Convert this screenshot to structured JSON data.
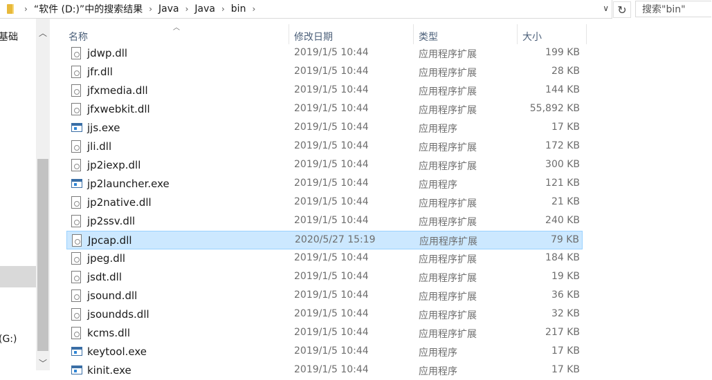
{
  "address": {
    "crumbs": [
      "“软件 (D:)”中的搜索结果",
      "Java",
      "Java",
      "bin"
    ]
  },
  "search": {
    "placeholder": "搜索\"bin\""
  },
  "nav": {
    "item_top": "基础",
    "item_drive": "(G:)"
  },
  "columns": {
    "name": "名称",
    "date": "修改日期",
    "type": "类型",
    "size": "大小"
  },
  "files": [
    {
      "name": "jdwp.dll",
      "date": "2019/1/5 10:44",
      "type": "应用程序扩展",
      "size": "199 KB",
      "kind": "dll"
    },
    {
      "name": "jfr.dll",
      "date": "2019/1/5 10:44",
      "type": "应用程序扩展",
      "size": "28 KB",
      "kind": "dll"
    },
    {
      "name": "jfxmedia.dll",
      "date": "2019/1/5 10:44",
      "type": "应用程序扩展",
      "size": "144 KB",
      "kind": "dll"
    },
    {
      "name": "jfxwebkit.dll",
      "date": "2019/1/5 10:44",
      "type": "应用程序扩展",
      "size": "55,892 KB",
      "kind": "dll"
    },
    {
      "name": "jjs.exe",
      "date": "2019/1/5 10:44",
      "type": "应用程序",
      "size": "17 KB",
      "kind": "exe"
    },
    {
      "name": "jli.dll",
      "date": "2019/1/5 10:44",
      "type": "应用程序扩展",
      "size": "172 KB",
      "kind": "dll"
    },
    {
      "name": "jp2iexp.dll",
      "date": "2019/1/5 10:44",
      "type": "应用程序扩展",
      "size": "300 KB",
      "kind": "dll"
    },
    {
      "name": "jp2launcher.exe",
      "date": "2019/1/5 10:44",
      "type": "应用程序",
      "size": "121 KB",
      "kind": "exe"
    },
    {
      "name": "jp2native.dll",
      "date": "2019/1/5 10:44",
      "type": "应用程序扩展",
      "size": "21 KB",
      "kind": "dll"
    },
    {
      "name": "jp2ssv.dll",
      "date": "2019/1/5 10:44",
      "type": "应用程序扩展",
      "size": "240 KB",
      "kind": "dll"
    },
    {
      "name": "Jpcap.dll",
      "date": "2020/5/27 15:19",
      "type": "应用程序扩展",
      "size": "79 KB",
      "kind": "dll",
      "selected": true
    },
    {
      "name": "jpeg.dll",
      "date": "2019/1/5 10:44",
      "type": "应用程序扩展",
      "size": "184 KB",
      "kind": "dll"
    },
    {
      "name": "jsdt.dll",
      "date": "2019/1/5 10:44",
      "type": "应用程序扩展",
      "size": "19 KB",
      "kind": "dll"
    },
    {
      "name": "jsound.dll",
      "date": "2019/1/5 10:44",
      "type": "应用程序扩展",
      "size": "36 KB",
      "kind": "dll"
    },
    {
      "name": "jsoundds.dll",
      "date": "2019/1/5 10:44",
      "type": "应用程序扩展",
      "size": "32 KB",
      "kind": "dll"
    },
    {
      "name": "kcms.dll",
      "date": "2019/1/5 10:44",
      "type": "应用程序扩展",
      "size": "217 KB",
      "kind": "dll"
    },
    {
      "name": "keytool.exe",
      "date": "2019/1/5 10:44",
      "type": "应用程序",
      "size": "17 KB",
      "kind": "exe"
    },
    {
      "name": "kinit.exe",
      "date": "2019/1/5 10:44",
      "type": "应用程序",
      "size": "17 KB",
      "kind": "exe"
    }
  ]
}
